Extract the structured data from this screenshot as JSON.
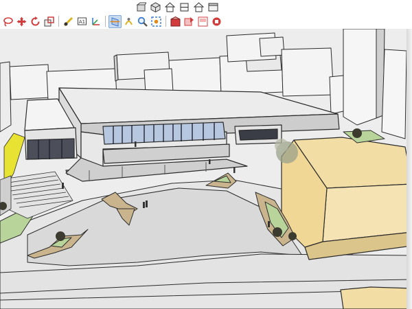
{
  "toolbar_top": [
    {
      "name": "components-icon",
      "icon": "box"
    },
    {
      "name": "iso-view-icon",
      "icon": "cube"
    },
    {
      "name": "front-view-icon",
      "icon": "house"
    },
    {
      "name": "top-view-icon",
      "icon": "house-top"
    },
    {
      "name": "right-view-icon",
      "icon": "house"
    },
    {
      "name": "back-view-icon",
      "icon": "box-flat"
    }
  ],
  "toolbar_main": [
    {
      "name": "lasso-select-icon",
      "icon": "lasso",
      "color": "#d23c3c"
    },
    {
      "name": "move-icon",
      "icon": "move",
      "color": "#d23c3c"
    },
    {
      "name": "rotate-icon",
      "icon": "rotate",
      "color": "#d23c3c"
    },
    {
      "name": "scale-icon",
      "icon": "scale",
      "color": "#d23c3c"
    },
    {
      "sep": true
    },
    {
      "name": "tape-measure-icon",
      "icon": "tape",
      "color": "#d9b320"
    },
    {
      "name": "text-label-icon",
      "icon": "text",
      "color": "#555555"
    },
    {
      "name": "axes-icon",
      "icon": "axes",
      "color": "#d9b320"
    },
    {
      "sep": true
    },
    {
      "name": "section-plane-icon",
      "icon": "section",
      "color": "#3b7bd3",
      "active": true
    },
    {
      "name": "walk-icon",
      "icon": "walk",
      "color": "#d9b320"
    },
    {
      "name": "zoom-icon",
      "icon": "zoom",
      "color": "#3b7bd3"
    },
    {
      "name": "zoom-extents-icon",
      "icon": "extents",
      "color": "#3b7bd3"
    },
    {
      "sep": true
    },
    {
      "name": "get-models-icon",
      "icon": "warehouse",
      "color": "#d23c3c"
    },
    {
      "name": "share-model-icon",
      "icon": "share",
      "color": "#d23c3c"
    },
    {
      "name": "send-to-layout-icon",
      "icon": "layout",
      "color": "#d23c3c"
    },
    {
      "name": "extension-warehouse-icon",
      "icon": "ext",
      "color": "#d23c3c"
    }
  ],
  "colors": {
    "sky": "#ededed",
    "building_white": "#f4f4f4",
    "building_shade": "#cfcfcf",
    "plaza": "#d9d9d9",
    "ground_light": "#eaeaea",
    "yellow_block": "#f2dda5",
    "yellow_block_shade": "#dcc58b",
    "tan_planter": "#c9b48e",
    "green": "#b8d49a",
    "glass": "#b7c7e0",
    "yellow_accent": "#e8e233",
    "outline": "#2b2b2b"
  }
}
